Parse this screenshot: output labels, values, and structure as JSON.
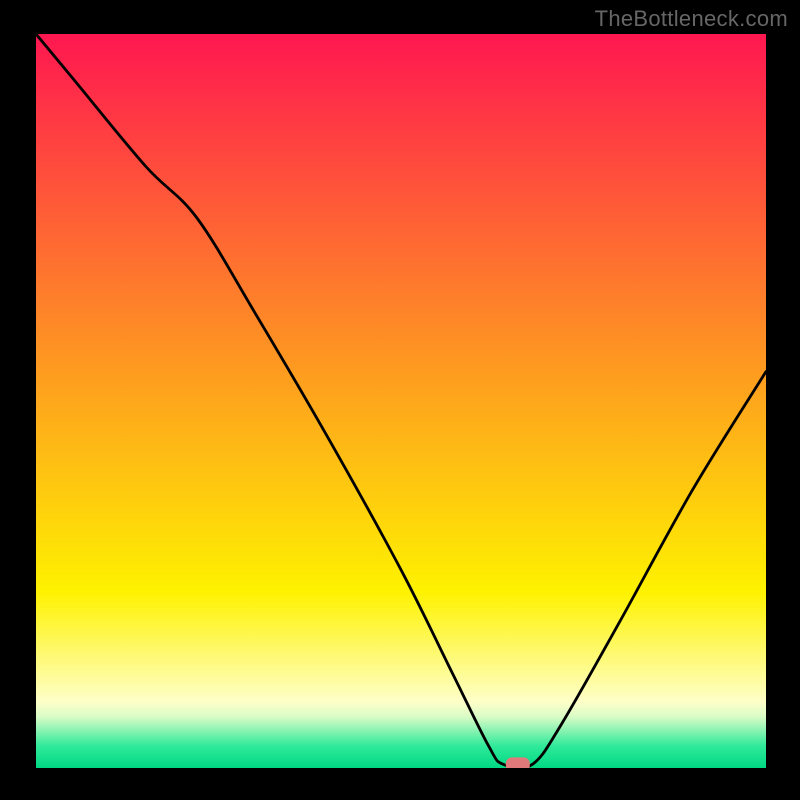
{
  "watermark": "TheBottleneck.com",
  "chart_data": {
    "type": "line",
    "title": "",
    "xlabel": "",
    "ylabel": "",
    "xlim": [
      0,
      100
    ],
    "ylim": [
      0,
      100
    ],
    "grid": false,
    "legend": false,
    "background": {
      "type": "vertical_gradient",
      "bands": [
        {
          "y0": 0,
          "y1": 76,
          "from": "#ff1750",
          "to": "#fef200"
        },
        {
          "y0": 76,
          "y1": 91,
          "from": "#fef200",
          "to": "#feffc8"
        },
        {
          "y0": 91,
          "y1": 93,
          "from": "#feffc8",
          "to": "#d8fbc6"
        },
        {
          "y0": 93,
          "y1": 97,
          "from": "#d8fbc6",
          "to": "#2fea9a"
        },
        {
          "y0": 97,
          "y1": 100,
          "from": "#2fea9a",
          "to": "#00d884"
        }
      ]
    },
    "series": [
      {
        "name": "bottleneck-curve",
        "x": [
          0,
          5,
          15,
          22,
          30,
          40,
          50,
          57,
          62,
          64,
          68,
          72,
          80,
          90,
          100
        ],
        "y": [
          100,
          94,
          82,
          75,
          62,
          45,
          27,
          13,
          3,
          0.5,
          0.5,
          6,
          20,
          38,
          54
        ]
      }
    ],
    "marker": {
      "x": 66,
      "y": 0.5,
      "shape": "pill",
      "color": "#e07a7a"
    }
  }
}
